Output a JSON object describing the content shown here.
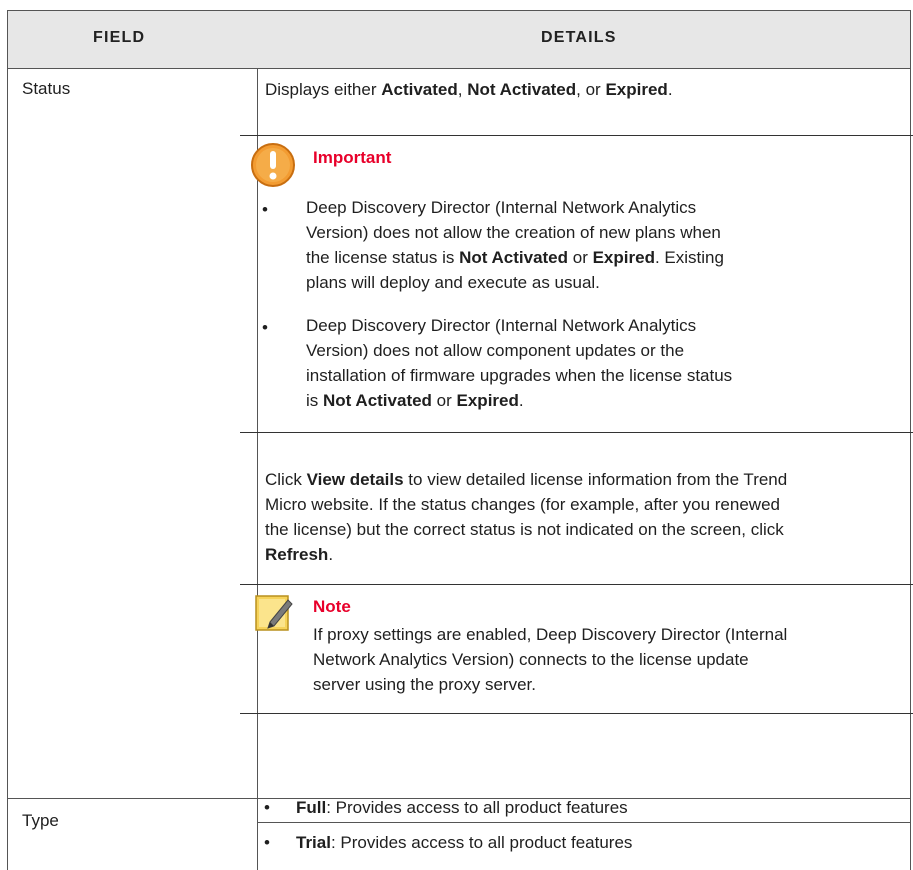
{
  "header": {
    "field": "Field",
    "details": "Details"
  },
  "status_row": {
    "label": "Status",
    "intro": {
      "prefix": "Displays either ",
      "a": "Activated",
      "sep1": ", ",
      "b": "Not Activated",
      "sep2": ", or ",
      "c": "Expired",
      "end": "."
    },
    "important": {
      "title": "Important",
      "bullet1": {
        "l1": "Deep Discovery Director (Internal Network Analytics",
        "l2": "Version) does not allow the creation of new plans when",
        "l3pre": "the license status is ",
        "l3b1": "Not Activated",
        "l3mid": " or ",
        "l3b2": "Expired",
        "l3end": ". Existing",
        "l4": "plans will deploy and execute as usual."
      },
      "bullet2": {
        "l1": "Deep Discovery Director (Internal Network Analytics",
        "l2": "Version) does not allow component updates or the",
        "l3": "installation of firmware upgrades when the license status",
        "l4pre": "is ",
        "l4b1": "Not Activated",
        "l4mid": " or ",
        "l4b2": "Expired",
        "l4end": "."
      }
    },
    "click": {
      "l1pre": "Click ",
      "l1b": "View details",
      "l1post": " to view detailed license information from the Trend",
      "l2": "Micro website. If the status changes (for example, after you renewed",
      "l3": "the license) but the correct status is not indicated on the screen, click",
      "l4b": "Refresh",
      "l4post": "."
    },
    "note": {
      "title": "Note",
      "l1": "If proxy settings are enabled, Deep Discovery Director (Internal",
      "l2": "Network Analytics Version) connects to the license update",
      "l3": "server using the proxy server."
    }
  },
  "type_row": {
    "label": "Type",
    "items": [
      {
        "bold": "Full",
        "text": ": Provides access to all product features"
      },
      {
        "bold": "Trial",
        "text": ": Provides access to all product features"
      }
    ]
  },
  "bullet_char": "•",
  "colors": {
    "important": "#e8002a",
    "header_bg": "#e7e7e7",
    "important_icon": "#f39c32",
    "note_icon": "#f6d35a"
  }
}
